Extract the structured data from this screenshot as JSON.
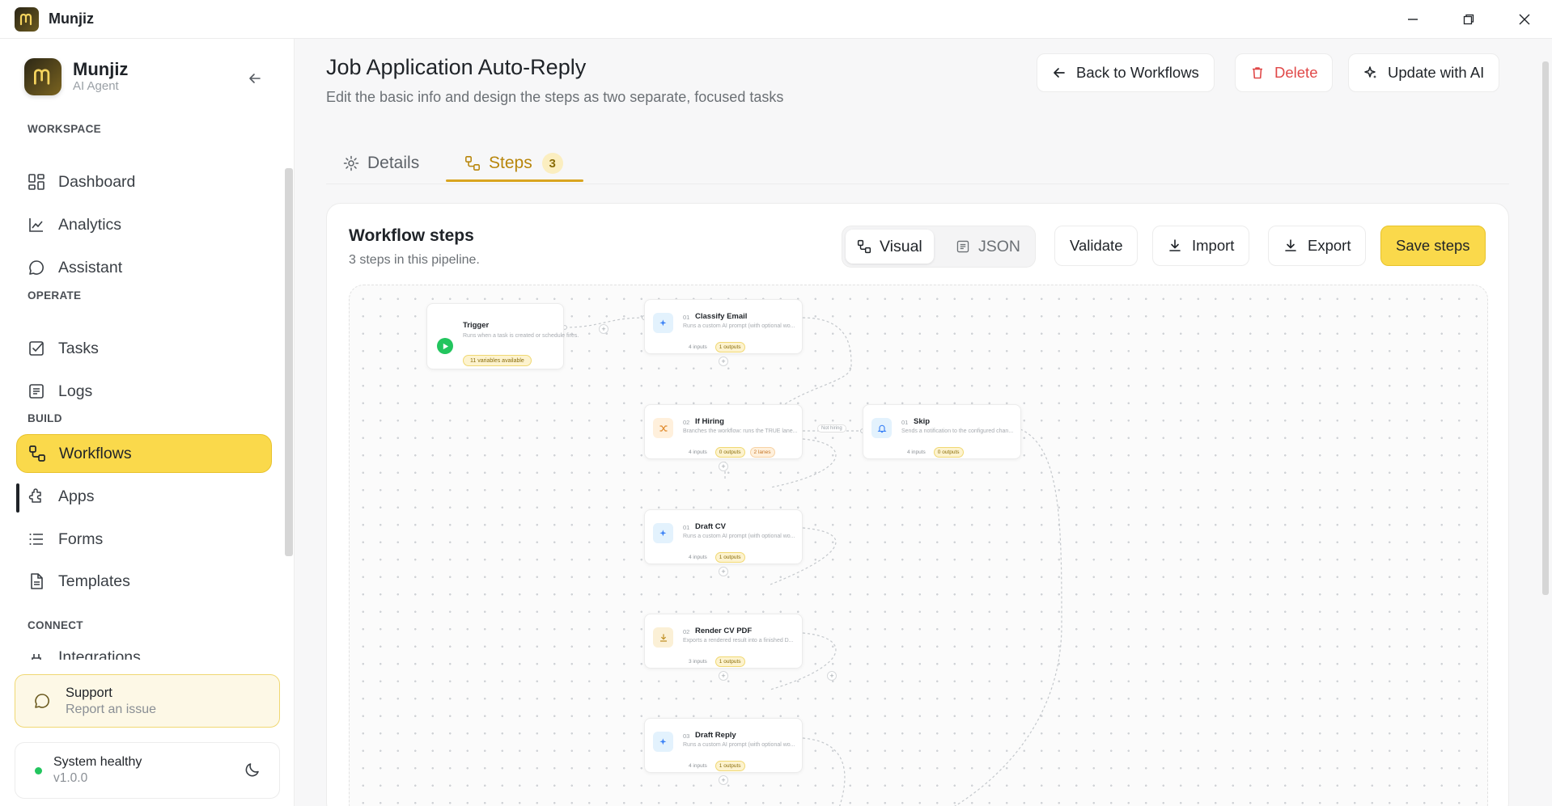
{
  "window": {
    "app_name": "Munjiz"
  },
  "sidebar": {
    "brand_name": "Munjiz",
    "brand_sub": "AI Agent",
    "sections": [
      {
        "label": "WORKSPACE"
      },
      {
        "label": "OPERATE"
      },
      {
        "label": "BUILD"
      },
      {
        "label": "CONNECT"
      }
    ],
    "items": [
      {
        "label": "Dashboard",
        "icon": "grid-icon"
      },
      {
        "label": "Analytics",
        "icon": "chart-line-icon"
      },
      {
        "label": "Assistant",
        "icon": "chat-bubble-icon"
      },
      {
        "label": "Tasks",
        "icon": "checkbox-icon"
      },
      {
        "label": "Logs",
        "icon": "document-lines-icon"
      },
      {
        "label": "Workflows",
        "icon": "workflow-icon",
        "active": true
      },
      {
        "label": "Apps",
        "icon": "puzzle-icon"
      },
      {
        "label": "Forms",
        "icon": "list-icon"
      },
      {
        "label": "Templates",
        "icon": "file-icon"
      },
      {
        "label": "Integrations",
        "icon": "plug-icon"
      }
    ],
    "support": {
      "title": "Support",
      "subtitle": "Report an issue"
    },
    "status": {
      "title": "System healthy",
      "version": "v1.0.0",
      "color": "#22c55e"
    }
  },
  "header": {
    "title": "Job Application Auto-Reply",
    "subtitle": "Edit the basic info and design the steps as two separate, focused tasks",
    "back_label": "Back to Workflows",
    "delete_label": "Delete",
    "update_label": "Update with AI"
  },
  "tabs": [
    {
      "label": "Details"
    },
    {
      "label": "Steps",
      "badge": "3",
      "active": true
    }
  ],
  "workflow": {
    "title": "Workflow steps",
    "subtitle": "3 steps in this pipeline.",
    "view_visual": "Visual",
    "view_json": "JSON",
    "validate_label": "Validate",
    "import_label": "Import",
    "export_label": "Export",
    "save_label": "Save steps"
  },
  "canvas": {
    "trigger": {
      "title": "Trigger",
      "desc": "Runs when a task is created or schedule fires.",
      "chip": "11 variables available"
    },
    "nodes": [
      {
        "num": "01",
        "title": "Classify Email",
        "desc": "Runs a custom AI prompt (with optional wo...",
        "inputs": "4 inputs",
        "outputs": "1 outputs",
        "icon": "sparkle-icon"
      },
      {
        "num": "02",
        "title": "If Hiring",
        "desc": "Branches the workflow: runs the TRUE lane...",
        "inputs": "4 inputs",
        "outputs": "0 outputs",
        "lanes": "2 lanes",
        "icon": "shuffle-icon"
      },
      {
        "num": "01",
        "title": "Skip",
        "desc": "Sends a notification to the configured chan...",
        "inputs": "4 inputs",
        "outputs": "0 outputs",
        "icon": "bell-icon"
      },
      {
        "num": "01",
        "title": "Draft CV",
        "desc": "Runs a custom AI prompt (with optional wo...",
        "inputs": "4 inputs",
        "outputs": "1 outputs",
        "icon": "sparkle-icon"
      },
      {
        "num": "02",
        "title": "Render CV PDF",
        "desc": "Exports a rendered result into a finished D...",
        "inputs": "3 inputs",
        "outputs": "1 outputs",
        "icon": "download-icon"
      },
      {
        "num": "03",
        "title": "Draft Reply",
        "desc": "Runs a custom AI prompt (with optional wo...",
        "inputs": "4 inputs",
        "outputs": "1 outputs",
        "icon": "sparkle-icon"
      }
    ],
    "edge_label": "Not hiring"
  }
}
